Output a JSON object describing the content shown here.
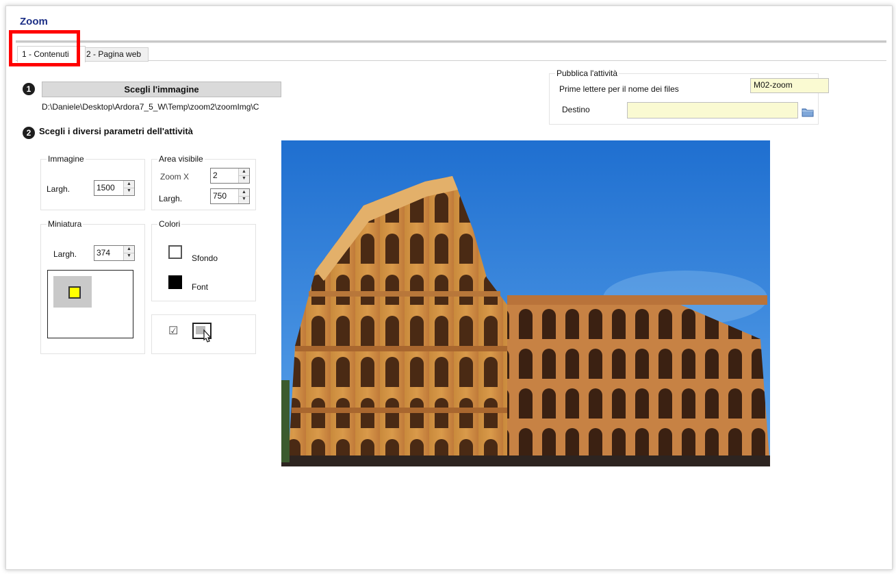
{
  "window": {
    "title": "Zoom"
  },
  "tabs": [
    {
      "label": "1 - Contenuti",
      "active": true
    },
    {
      "label": "2 - Pagina web",
      "active": false
    }
  ],
  "step1": {
    "number": "1",
    "choose_button": "Scegli l'immagine",
    "image_path": "D:\\Daniele\\Desktop\\Ardora7_5_W\\Temp\\zoom2\\zoomImg\\C"
  },
  "step2": {
    "number": "2",
    "title": "Scegli i diversi parametri dell'attività"
  },
  "immagine": {
    "group_label": "Immagine",
    "width_label": "Largh.",
    "width_value": "1500"
  },
  "area_visibile": {
    "group_label": "Area visibile",
    "zoom_label": "Zoom X",
    "zoom_value": "2",
    "width_label": "Largh.",
    "width_value": "750"
  },
  "miniatura": {
    "group_label": "Miniatura",
    "width_label": "Largh.",
    "width_value": "374"
  },
  "colori": {
    "group_label": "Colori",
    "background_label": "Sfondo",
    "background_color": "#ffffff",
    "font_label": "Font",
    "font_color": "#000000"
  },
  "options": {
    "checkbox_checked": true,
    "checkbox_glyph": "☑"
  },
  "publish": {
    "group_label": "Pubblica l'attività",
    "prefix_label": "Prime lettere per il nome dei files",
    "prefix_value": "M02-zoom",
    "dest_label": "Destino",
    "dest_value": ""
  },
  "colors": {
    "title": "#1c2f86",
    "highlight": "#ff0000",
    "input_bg": "#fafad2",
    "sky": "#2a7fd8"
  }
}
